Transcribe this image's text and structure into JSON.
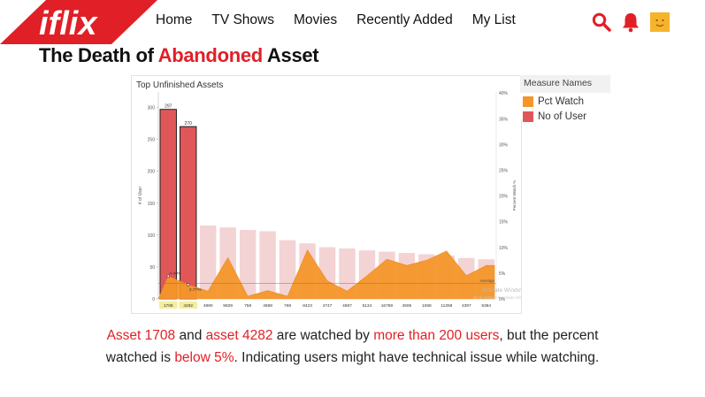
{
  "nav": {
    "logo_text": "iflix",
    "links": [
      "Home",
      "TV Shows",
      "Movies",
      "Recently Added",
      "My List"
    ],
    "brand_color": "#e11f26"
  },
  "icons": [
    "search-icon",
    "bell-icon",
    "profile-avatar-icon"
  ],
  "page_title": {
    "part1": "The Death of ",
    "part2": "Abandoned",
    "part3": " Asset"
  },
  "chart_card": {
    "title": "Top Unfinished Assets",
    "watermark_line1": "Activate Windows",
    "watermark_line2": "Go to Settings to activate Windows."
  },
  "legend": {
    "title": "Measure Names",
    "items": [
      {
        "label": "Pct Watch",
        "color": "#f4962a"
      },
      {
        "label": "No of User",
        "color": "#e15759"
      }
    ]
  },
  "chart_data": {
    "type": "bar",
    "title": "Top Unfinished Assets",
    "xlabel": "",
    "ylabel": "# of User",
    "y2label": "Percent Watch %",
    "categories": [
      "1708",
      "4282",
      "4890",
      "9829",
      "758",
      "4968",
      "769",
      "8423",
      "4747",
      "4887",
      "5134",
      "16769",
      "4505",
      "1068",
      "11358",
      "4397",
      "9384"
    ],
    "series": [
      {
        "name": "No of User",
        "axis": "left",
        "values": [
          297,
          270,
          115,
          112,
          108,
          106,
          92,
          87,
          81,
          79,
          76,
          74,
          72,
          70,
          68,
          64,
          62
        ]
      },
      {
        "name": "Pct Watch",
        "axis": "right",
        "values": [
          4.4,
          2.77,
          1.5,
          8,
          0.5,
          1.6,
          0.5,
          9.5,
          3.5,
          1.5,
          4.5,
          7.7,
          6.5,
          7.5,
          9.3,
          4.5,
          6.5
        ]
      }
    ],
    "ylim": [
      0,
      300
    ],
    "y_ticks": [
      0,
      50,
      100,
      150,
      200,
      250,
      300
    ],
    "y2lim": [
      0,
      40
    ],
    "y2_ticks": [
      0,
      5,
      10,
      15,
      20,
      25,
      30,
      35,
      40
    ],
    "y2_tick_labels": [
      "0%",
      "5%",
      "10%",
      "15%",
      "20%",
      "25%",
      "30%",
      "35%",
      "40%"
    ],
    "data_labels": {
      "1708": {
        "users": "297",
        "pct": "4.40%"
      },
      "4282": {
        "users": "270",
        "pct": "2.77%"
      }
    },
    "highlighted": [
      "1708",
      "4282"
    ],
    "reference_line": {
      "label": "Average",
      "value": 3
    },
    "grid": false,
    "legend_position": "right"
  },
  "caption": {
    "line1": [
      {
        "text": "Asset 1708",
        "hl": true
      },
      {
        "text": " and ",
        "hl": false
      },
      {
        "text": "asset 4282",
        "hl": true
      },
      {
        "text": " are watched by ",
        "hl": false
      },
      {
        "text": "more than 200 users",
        "hl": true
      },
      {
        "text": ", but the percent",
        "hl": false
      }
    ],
    "line2": [
      {
        "text": "watched is ",
        "hl": false
      },
      {
        "text": "below 5%",
        "hl": true
      },
      {
        "text": ". Indicating users might have technical issue while watching.",
        "hl": false
      }
    ]
  }
}
